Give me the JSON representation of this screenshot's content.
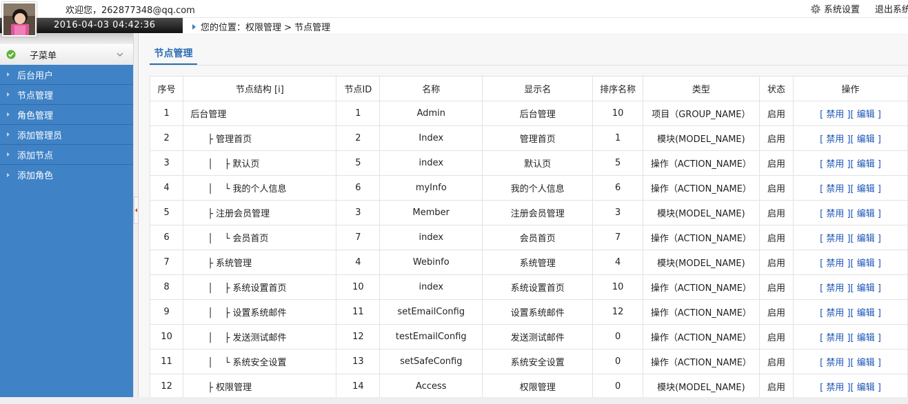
{
  "header": {
    "welcome": "欢迎您，262877348@qq.com",
    "datetime": "2016-04-03 04:42:36",
    "settings_label": "系统设置",
    "logout_label": "退出系统"
  },
  "breadcrumb": "您的位置：权限管理 > 节点管理",
  "sidebar": {
    "header": "子菜单",
    "items": [
      {
        "label": "后台用户"
      },
      {
        "label": "节点管理"
      },
      {
        "label": "角色管理"
      },
      {
        "label": "添加管理员"
      },
      {
        "label": "添加节点"
      },
      {
        "label": "添加角色"
      }
    ]
  },
  "content": {
    "tab_title": "节点管理",
    "columns": [
      "序号",
      "节点结构 [i]",
      "节点ID",
      "名称",
      "显示名",
      "排序名称",
      "类型",
      "状态",
      "操作"
    ],
    "op_disable": "[ 禁用 ]",
    "op_edit": "[ 编辑 ]",
    "rows": [
      {
        "seq": "1",
        "tree": "后台管理",
        "id": "1",
        "name": "Admin",
        "display": "后台管理",
        "sort": "10",
        "type": "项目（GROUP_NAME）",
        "status": "启用"
      },
      {
        "seq": "2",
        "tree": "      ├ 管理首页",
        "id": "2",
        "name": "Index",
        "display": "管理首页",
        "sort": "1",
        "type": "模块(MODEL_NAME)",
        "status": "启用"
      },
      {
        "seq": "3",
        "tree": "      │    ├ 默认页",
        "id": "5",
        "name": "index",
        "display": "默认页",
        "sort": "5",
        "type": "操作（ACTION_NAME）",
        "status": "启用"
      },
      {
        "seq": "4",
        "tree": "      │    └ 我的个人信息",
        "id": "6",
        "name": "myInfo",
        "display": "我的个人信息",
        "sort": "6",
        "type": "操作（ACTION_NAME）",
        "status": "启用"
      },
      {
        "seq": "5",
        "tree": "      ├ 注册会员管理",
        "id": "3",
        "name": "Member",
        "display": "注册会员管理",
        "sort": "3",
        "type": "模块(MODEL_NAME)",
        "status": "启用"
      },
      {
        "seq": "6",
        "tree": "      │    └ 会员首页",
        "id": "7",
        "name": "index",
        "display": "会员首页",
        "sort": "7",
        "type": "操作（ACTION_NAME）",
        "status": "启用"
      },
      {
        "seq": "7",
        "tree": "      ├ 系统管理",
        "id": "4",
        "name": "Webinfo",
        "display": "系统管理",
        "sort": "4",
        "type": "模块(MODEL_NAME)",
        "status": "启用"
      },
      {
        "seq": "8",
        "tree": "      │    ├ 系统设置首页",
        "id": "10",
        "name": "index",
        "display": "系统设置首页",
        "sort": "10",
        "type": "操作（ACTION_NAME）",
        "status": "启用"
      },
      {
        "seq": "9",
        "tree": "      │    ├ 设置系统邮件",
        "id": "11",
        "name": "setEmailConfig",
        "display": "设置系统邮件",
        "sort": "12",
        "type": "操作（ACTION_NAME）",
        "status": "启用"
      },
      {
        "seq": "10",
        "tree": "      │    ├ 发送测试邮件",
        "id": "12",
        "name": "testEmailConfig",
        "display": "发送测试邮件",
        "sort": "0",
        "type": "操作（ACTION_NAME）",
        "status": "启用"
      },
      {
        "seq": "11",
        "tree": "      │    └ 系统安全设置",
        "id": "13",
        "name": "setSafeConfig",
        "display": "系统安全设置",
        "sort": "0",
        "type": "操作（ACTION_NAME）",
        "status": "启用"
      },
      {
        "seq": "12",
        "tree": "      ├ 权限管理",
        "id": "14",
        "name": "Access",
        "display": "权限管理",
        "sort": "0",
        "type": "模块(MODEL_NAME)",
        "status": "启用"
      }
    ]
  },
  "colors": {
    "sidebar_bg": "#3f82c6",
    "accent": "#2a6db0",
    "link": "#1a54b6"
  }
}
